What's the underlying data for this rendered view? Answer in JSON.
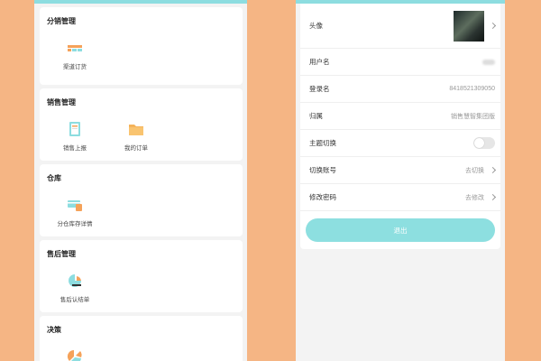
{
  "left": {
    "sections": [
      {
        "title": "分销管理",
        "items": [
          {
            "label": "渠道订货",
            "icon": "channel-order-icon"
          }
        ]
      },
      {
        "title": "销售管理",
        "items": [
          {
            "label": "销售上报",
            "icon": "sales-report-icon"
          },
          {
            "label": "我的订单",
            "icon": "folder-icon"
          }
        ]
      },
      {
        "title": "仓库",
        "items": [
          {
            "label": "分仓库存详情",
            "icon": "warehouse-icon"
          }
        ]
      },
      {
        "title": "售后管理",
        "items": [
          {
            "label": "售后认结单",
            "icon": "after-sales-icon"
          }
        ]
      },
      {
        "title": "决策",
        "items": [
          {
            "label": "",
            "icon": "pie-chart-icon"
          }
        ]
      }
    ]
  },
  "right": {
    "rows": {
      "avatar_label": "头像",
      "username_label": "用户名",
      "username_value": "",
      "login_label": "登录名",
      "login_value": "8418521309050",
      "belong_label": "归属",
      "belong_value": "销售慧智集团版",
      "theme_label": "主题切换",
      "theme_enabled": false,
      "switch_label": "切换账号",
      "switch_value": "去切换",
      "password_label": "修改密码",
      "password_value": "去修改"
    },
    "logout_label": "退出"
  },
  "colors": {
    "background": "#f5b584",
    "accent": "#8ddde0"
  }
}
